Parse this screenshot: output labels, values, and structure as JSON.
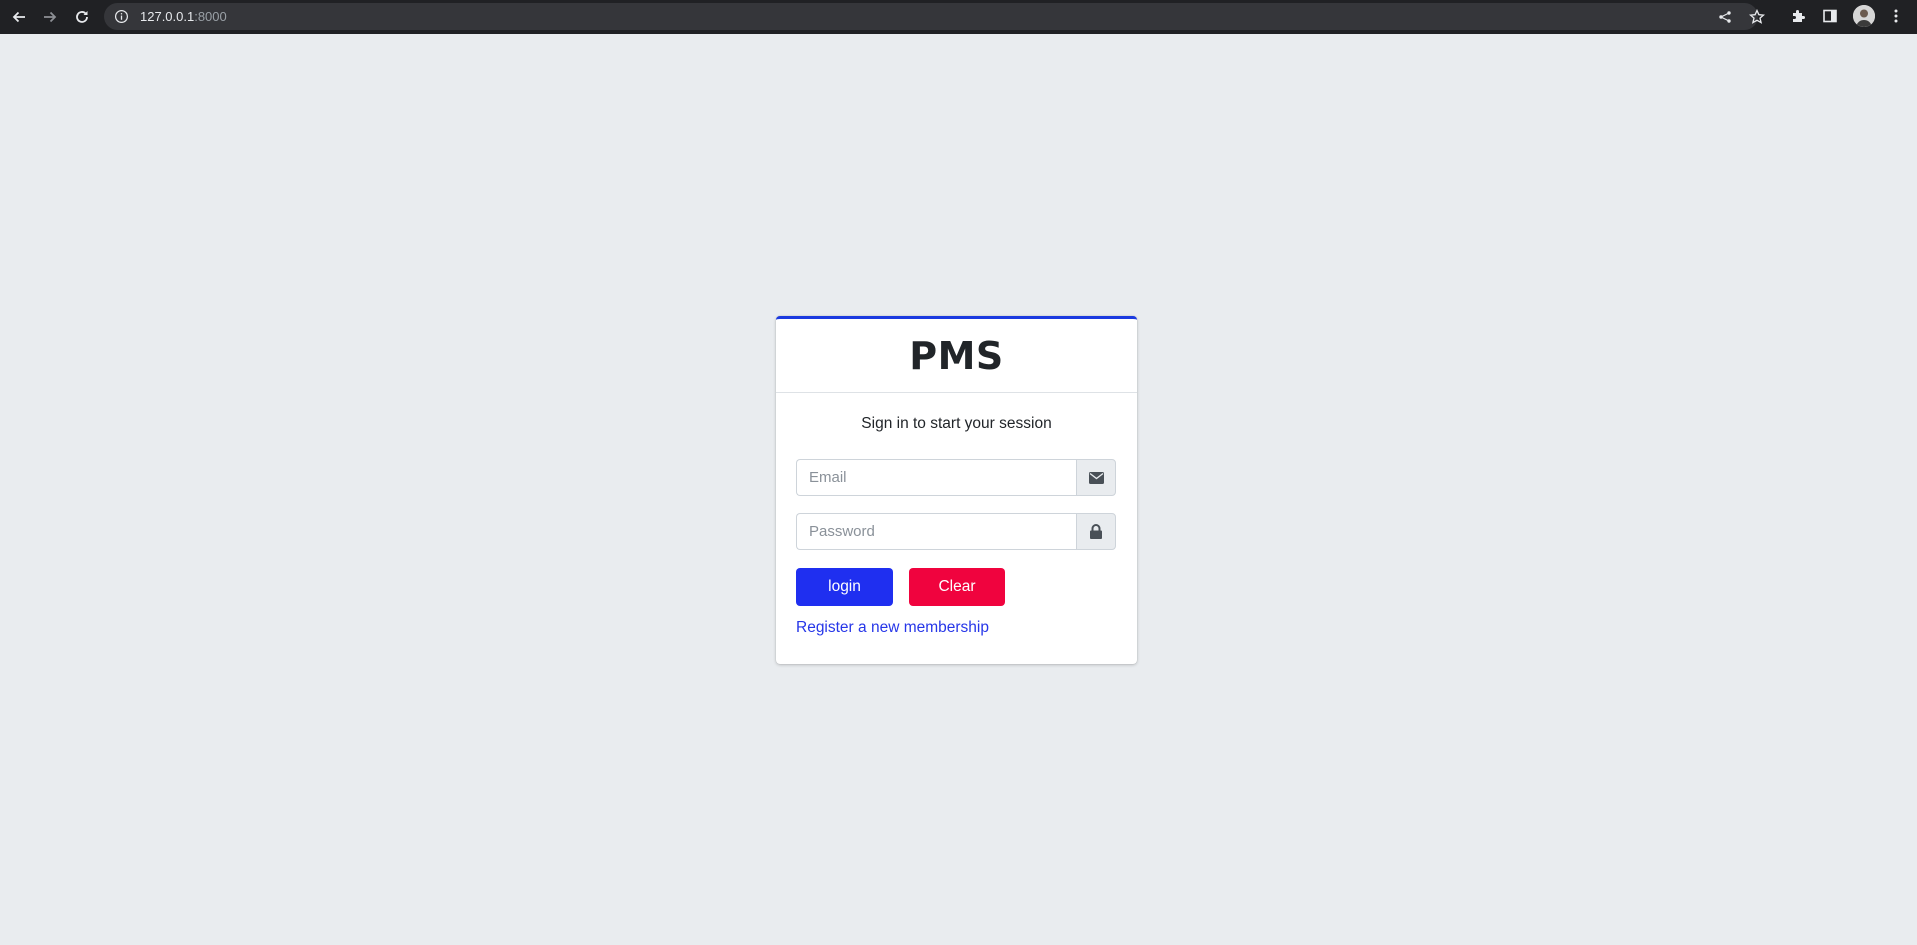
{
  "browser": {
    "url_host": "127.0.0.1",
    "url_port": ":8000"
  },
  "colors": {
    "page_bg": "#e9ecef",
    "card_accent": "#1b3ae0",
    "login_button": "#1f2ff0",
    "clear_button": "#f0033e",
    "link": "#2636e8"
  },
  "login": {
    "brand": "PMS",
    "message": "Sign in to start your session",
    "email_placeholder": "Email",
    "email_icon": "envelope-icon",
    "password_placeholder": "Password",
    "password_icon": "lock-icon",
    "login_label": "login",
    "clear_label": "Clear",
    "register_link": "Register a new membership"
  }
}
